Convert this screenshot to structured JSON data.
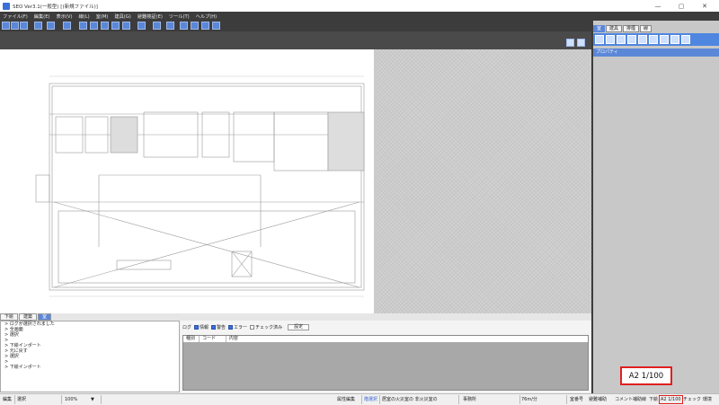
{
  "window": {
    "title": "SEO Ver3.1(一般型) [(新規ファイル)]",
    "controls": [
      "—",
      "▢",
      "✕"
    ]
  },
  "menubar": [
    "ファイル(F)",
    "編集(E)",
    "表示(V)",
    "線(L)",
    "室(M)",
    "建具(G)",
    "避難検証(E)",
    "ツール(T)",
    "ヘルプ(H)"
  ],
  "right_panel": {
    "tabs": [
      "室",
      "建具",
      "排煙",
      "線"
    ],
    "property_header": "プロパティ"
  },
  "bottom_tabs": [
    "下絵",
    "建築",
    "室"
  ],
  "log_lines": [
    "ログが選択されました",
    "全画面",
    "選択",
    "",
    "下絵インポート",
    "元に戻す",
    "選択",
    "",
    "下絵インポート"
  ],
  "log_filters": {
    "label": "ログ",
    "items": [
      {
        "label": "情報",
        "checked": true
      },
      {
        "label": "警告",
        "checked": true
      },
      {
        "label": "エラー",
        "checked": true
      },
      {
        "label": "チェック済み",
        "checked": false
      }
    ],
    "setting_button": "設定"
  },
  "log_grid_columns": [
    "種別",
    "コード",
    "内容"
  ],
  "status": {
    "mode": "編集",
    "action": "選択",
    "zoom": "100%",
    "attr_edit": "属性編集",
    "mode2": "階選択",
    "room_info": "居室の火災室の 非火災室の",
    "dept": "事務所",
    "rate": "76m/分",
    "items_right": [
      "室番号",
      "避難補助",
      "コメント",
      "補助線",
      "下絵"
    ],
    "scale": "A2 1/100",
    "check": "チェック",
    "env": "環境"
  },
  "scale_callout": "A2 1/100"
}
